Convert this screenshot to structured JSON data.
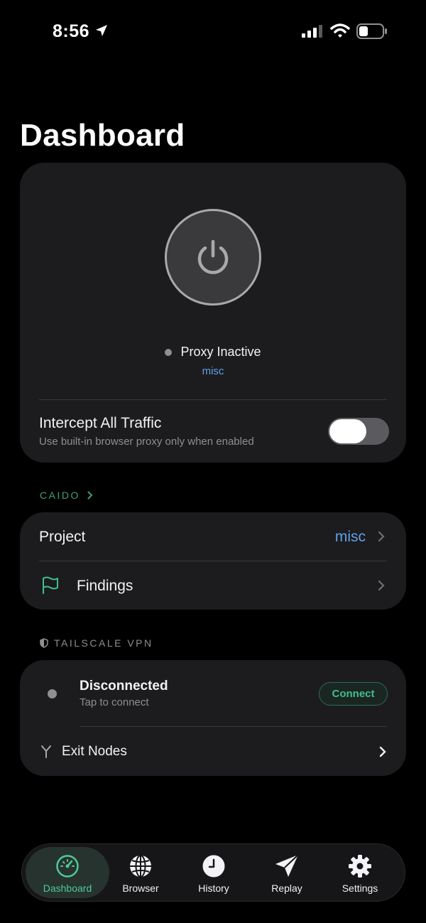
{
  "status_bar": {
    "time": "8:56",
    "icons": [
      "location-arrow-icon",
      "signal-icon",
      "wifi-icon",
      "battery-icon"
    ]
  },
  "page": {
    "title": "Dashboard"
  },
  "proxy": {
    "power_icon": "power-icon",
    "status": "Proxy Inactive",
    "project": "misc",
    "intercept_title": "Intercept All Traffic",
    "intercept_subtitle": "Use built-in browser proxy only when enabled",
    "intercept_enabled": false
  },
  "caido": {
    "header": "CAIDO",
    "project_label": "Project",
    "project_value": "misc",
    "findings_label": "Findings",
    "findings_icon": "flag-icon"
  },
  "vpn": {
    "header": "TAILSCALE VPN",
    "header_icon": "shield-icon",
    "status": "Disconnected",
    "subtitle": "Tap to connect",
    "connect_label": "Connect",
    "exit_nodes_label": "Exit Nodes",
    "exit_nodes_icon": "fork-icon"
  },
  "tabs": [
    {
      "label": "Dashboard",
      "icon": "gauge-icon",
      "active": true
    },
    {
      "label": "Browser",
      "icon": "globe-icon",
      "active": false
    },
    {
      "label": "History",
      "icon": "clock-icon",
      "active": false
    },
    {
      "label": "Replay",
      "icon": "paper-plane-icon",
      "active": false
    },
    {
      "label": "Settings",
      "icon": "gear-icon",
      "active": false
    }
  ],
  "colors": {
    "background": "#000000",
    "card": "#1c1c1e",
    "accent_green": "#3fbf8c",
    "link_blue": "#5fa0e8",
    "muted": "#8e8e93"
  }
}
